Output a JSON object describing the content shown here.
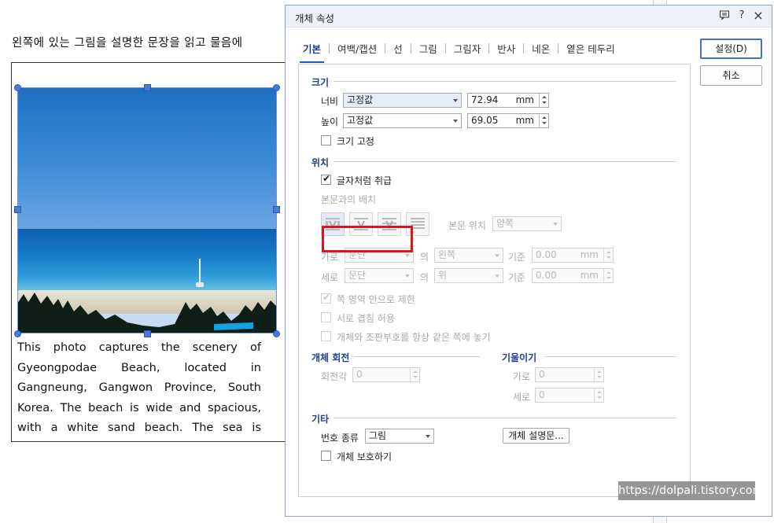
{
  "document": {
    "top_text": "왼쪽에 있는 그림을 설명한 문장을 읽고 물음에",
    "caption_lines": [
      "This photo captures the scenery of",
      "Gyeongpodae Beach, located in",
      "Gangneung, Gangwon Province, South",
      "Korea. The beach is wide and spacious,",
      "with a white sand beach. The sea is"
    ]
  },
  "dialog": {
    "title": "개체 속성",
    "titlebar_icons": [
      "comment-icon",
      "help-icon",
      "close-icon"
    ],
    "help_label": "?",
    "close_label": "×",
    "tabs": [
      "기본",
      "여백/캡션",
      "선",
      "그림",
      "그림자",
      "반사",
      "네온",
      "옅은 테두리"
    ],
    "active_tab": "기본",
    "buttons": {
      "ok": "설정(D)",
      "cancel": "취소"
    },
    "size": {
      "section": "크기",
      "width_label": "너비",
      "width_mode": "고정값",
      "width_value": "72.94",
      "width_unit": "mm",
      "height_label": "높이",
      "height_mode": "고정값",
      "height_value": "69.05",
      "height_unit": "mm",
      "lock_label": "크기 고정",
      "lock_checked": false
    },
    "position": {
      "section": "위치",
      "treat_as_char_label": "글자처럼 취급",
      "treat_as_char_checked": true,
      "wrap_label": "본문과의 배치",
      "text_pos_label": "본문 위치",
      "text_pos_value": "양쪽",
      "horiz_label": "가로",
      "horiz_ref": "문단",
      "horiz_of": "의",
      "horiz_align": "왼쪽",
      "horiz_base": "기준",
      "horiz_value": "0.00",
      "horiz_unit": "mm",
      "vert_label": "세로",
      "vert_ref": "문단",
      "vert_of": "의",
      "vert_align": "위",
      "vert_base": "기준",
      "vert_value": "0.00",
      "vert_unit": "mm",
      "limit_label": "쪽 영역 안으로 제한",
      "overlap_label": "서로 겹침 허용",
      "same_page_label": "개체와 조판부호를 항상 같은 쪽에 놓기"
    },
    "rotation": {
      "section": "개체 회전",
      "angle_label": "회전각",
      "angle_value": "0"
    },
    "tilt": {
      "section": "기울이기",
      "horiz_label": "가로",
      "horiz_value": "0",
      "vert_label": "세로",
      "vert_value": "0"
    },
    "other": {
      "section": "기타",
      "number_type_label": "번호 종류",
      "number_type_value": "그림",
      "description_button": "개체 설명문...",
      "protect_label": "개체 보호하기",
      "protect_checked": false
    }
  },
  "watermark": "https://dolpali.tistory.com",
  "colors": {
    "highlight_box": "#e0141e",
    "accent": "#1f56c7",
    "section_label": "#1d3f8c"
  }
}
